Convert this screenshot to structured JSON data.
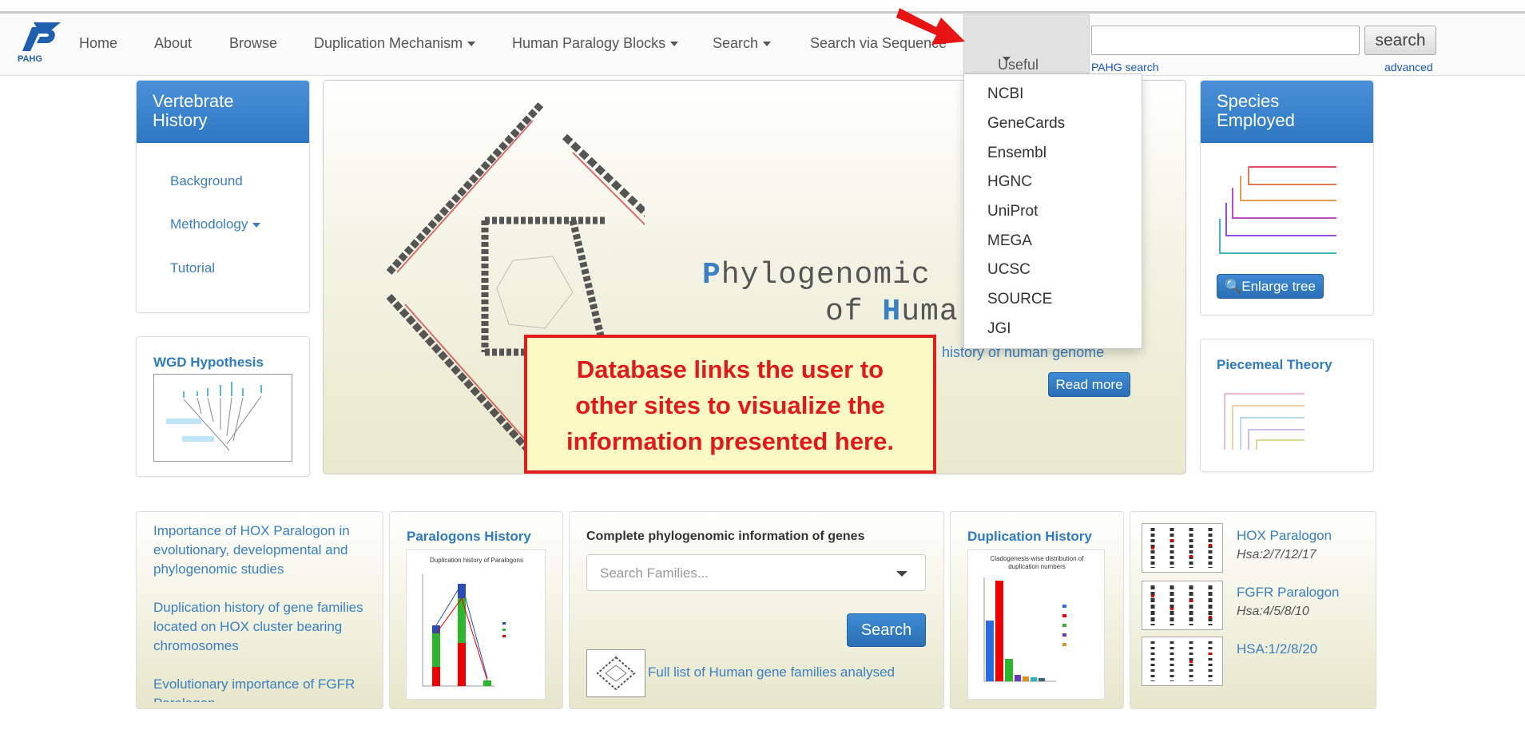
{
  "nav": {
    "items": [
      "Home",
      "About",
      "Browse",
      "Duplication Mechanism",
      "Human Paralogy Blocks",
      "Search",
      "Search via Sequence"
    ],
    "logo_text": "PAHG",
    "useful_links_label": "Useful Links",
    "search_button": "search",
    "pahg_search_label": "PAHG search",
    "advanced_label": "advanced"
  },
  "dropdown": {
    "items": [
      "NCBI",
      "GeneCards",
      "Ensembl",
      "HGNC",
      "UniProt",
      "MEGA",
      "UCSC",
      "SOURCE",
      "JGI"
    ]
  },
  "left_panel": {
    "title_line1": "Vertebrate",
    "title_line2": "History",
    "links": [
      "Background",
      "Methodology",
      "Tutorial"
    ]
  },
  "wgd": {
    "title": "WGD Hypothesis"
  },
  "hero": {
    "title_line1_first": "P",
    "title_line1_rest": "hylogenomic",
    "title_line2_of": "of",
    "title_line2_H": "H",
    "title_line2_rest": "uma",
    "subtitle": "history of human genome",
    "read_more": "Read more"
  },
  "species": {
    "title_line1": "Species",
    "title_line2": "Employed",
    "button": "Enlarge tree"
  },
  "piecemeal": {
    "title": "Piecemeal Theory"
  },
  "callout": {
    "line1": "Database links the user to",
    "line2": "other sites to visualize the",
    "line3": "information presented here."
  },
  "bottom": {
    "links": [
      "Importance of HOX Paralogon in evolutionary, developmental and phylogenomic studies",
      "Duplication history of gene families located on HOX cluster bearing chromosomes",
      "Evolutionary importance of FGFR Paralogon"
    ],
    "paralogons_title": "Paralogons History",
    "paralogons_chart_title": "Duplication history of Paralogons",
    "complete_title": "Complete phylogenomic information of genes",
    "search_placeholder": "Search Families...",
    "search_button": "Search",
    "full_list": "Full list of Human gene families analysed",
    "duplication_title": "Duplication History",
    "duplication_chart_title": "Cladogenesis-wise distribution of duplication numbers",
    "paralogons": [
      {
        "name": "HOX Paralogon",
        "sub": "Hsa:2/7/12/17"
      },
      {
        "name": "FGFR Paralogon",
        "sub": "Hsa:4/5/8/10"
      },
      {
        "name": "HSA:1/2/8/20",
        "sub": ""
      }
    ]
  },
  "colors": {
    "accent_blue": "#2d78c2",
    "link_blue": "#3a7fc1",
    "callout_red": "#e01a1a",
    "callout_bg": "#fdf9c4"
  }
}
